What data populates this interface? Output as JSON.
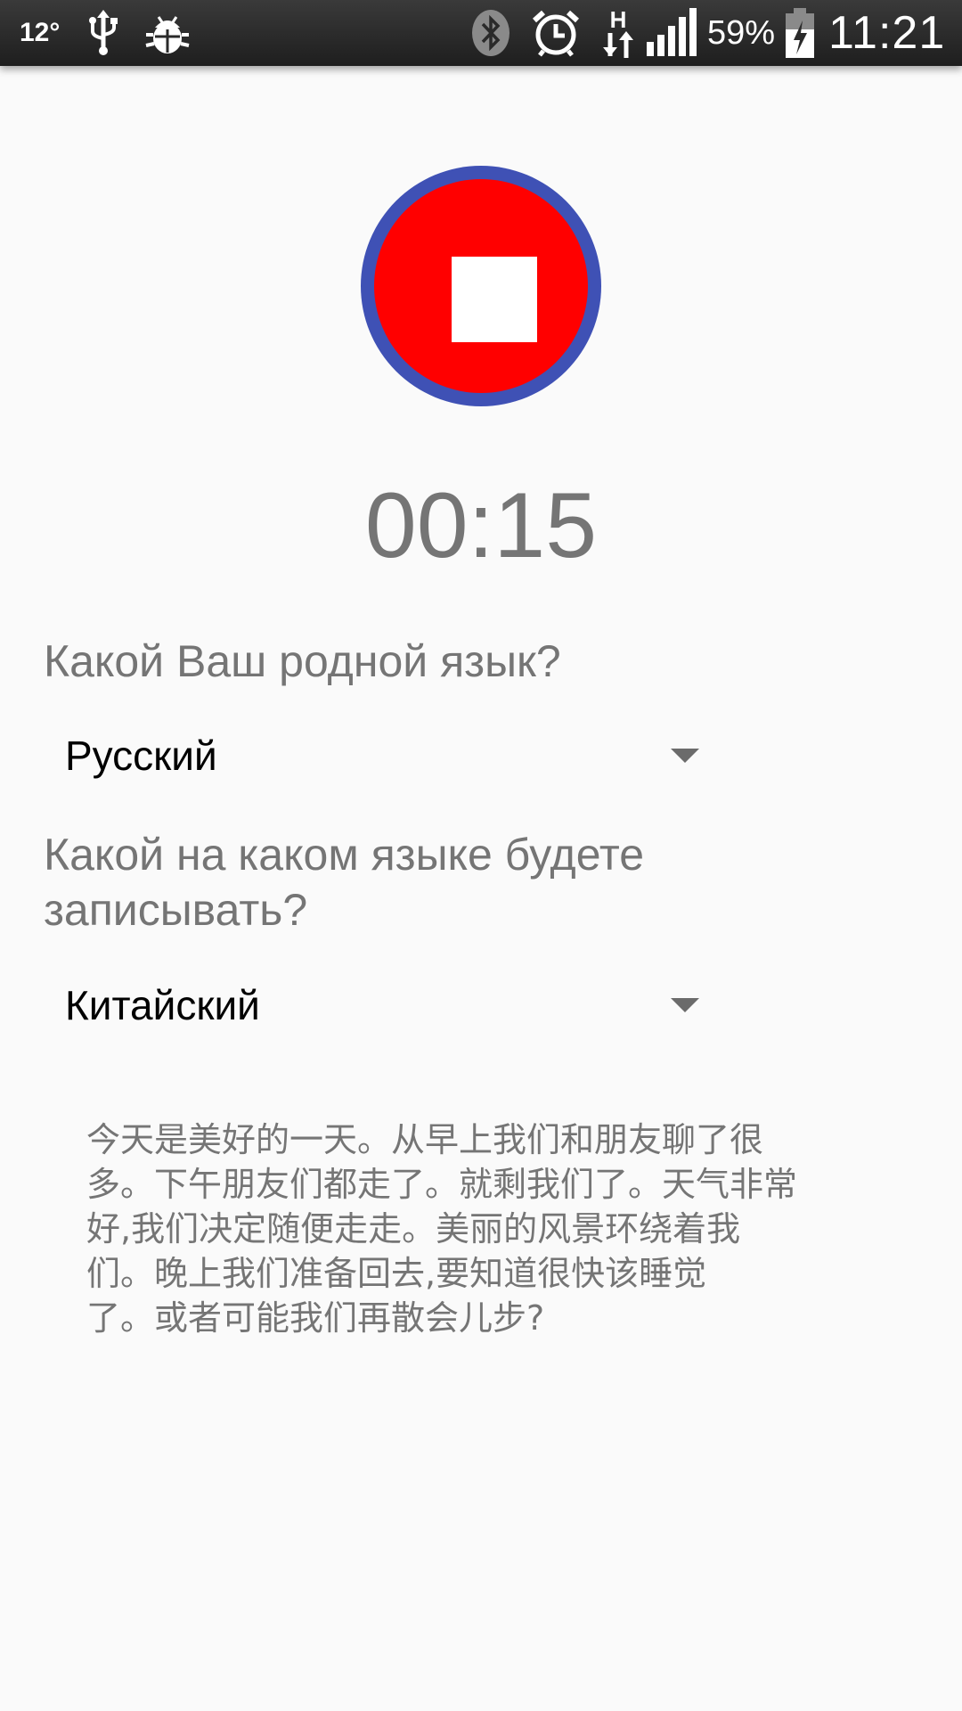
{
  "status_bar": {
    "temperature": "12°",
    "battery_percent": "59%",
    "clock": "11:21",
    "icons": [
      "usb-icon",
      "debug-icon",
      "bluetooth-icon",
      "alarm-icon",
      "data-transfer-icon",
      "signal-icon",
      "battery-charging-icon"
    ],
    "network_label": "H"
  },
  "recorder": {
    "button_state": "recording",
    "button_icon": "stop-icon",
    "colors": {
      "ring": "#3f51b5",
      "fill": "#ff0000",
      "icon": "#ffffff"
    },
    "timer": "00:15"
  },
  "form": {
    "native_language_question": "Какой Ваш родной язык?",
    "native_language_value": "Русский",
    "record_language_question": "Какой на каком языке будете записывать?",
    "record_language_question_lines": [
      "Какой на каком языке будете",
      "записывать?"
    ],
    "record_language_value": "Китайский"
  },
  "passage": {
    "lines": [
      "今天是美好的一天。从早上我们和朋友聊了很",
      "多。下午朋友们都走了。就剩我们了。天气非常",
      "好,我们决定随便走走。美丽的风景环绕着我",
      "们。晚上我们准备回去,要知道很快该睡觉",
      "了。或者可能我们再散会儿步?"
    ]
  }
}
